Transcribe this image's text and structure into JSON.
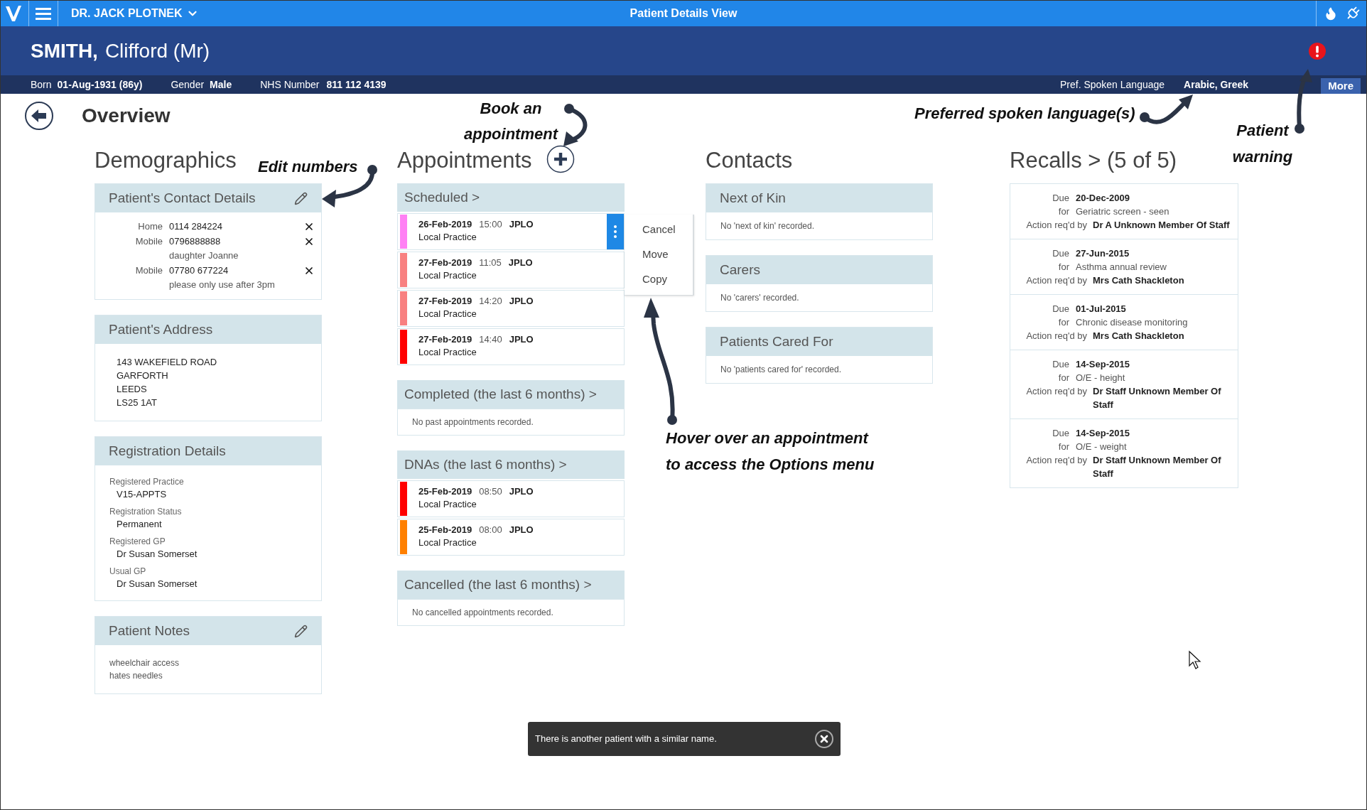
{
  "top_bar": {
    "user_name": "DR. JACK PLOTNEK",
    "title": "Patient Details View"
  },
  "patient": {
    "surname": "SMITH,",
    "given_name": "Clifford (Mr)",
    "born_label": "Born",
    "born": "01-Aug-1931 (86y)",
    "gender_label": "Gender",
    "gender": "Male",
    "nhs_label": "NHS Number",
    "nhs": "811 112 4139",
    "language_label": "Pref. Spoken Language",
    "language": "Arabic, Greek",
    "more_button": "More"
  },
  "page_title": "Overview",
  "demographics": {
    "heading": "Demographics",
    "contact_details": {
      "title": "Patient's Contact Details",
      "editable": true,
      "numbers": [
        {
          "type": "Home",
          "number": "0114 284224"
        },
        {
          "type": "Mobile",
          "number": "0796888888",
          "note": "daughter Joanne"
        },
        {
          "type": "Mobile",
          "number": "07780 677224",
          "note": "please only use after 3pm"
        }
      ]
    },
    "address": {
      "title": "Patient's Address",
      "editable": false,
      "lines": [
        "143 WAKEFIELD ROAD",
        "GARFORTH",
        "LEEDS",
        "LS25 1AT"
      ]
    },
    "registration": {
      "title": "Registration Details",
      "editable": false,
      "fields": [
        {
          "label": "Registered Practice",
          "value": "V15-APPTS"
        },
        {
          "label": "Registration Status",
          "value": "Permanent"
        },
        {
          "label": "Registered GP",
          "value": "Dr Susan Somerset"
        },
        {
          "label": "Usual GP",
          "value": "Dr Susan Somerset"
        }
      ]
    },
    "notes": {
      "title": "Patient Notes",
      "editable": true,
      "lines": [
        "wheelchair access",
        "hates needles"
      ]
    }
  },
  "appointments": {
    "heading": "Appointments",
    "options_menu": [
      "Cancel",
      "Move",
      "Copy"
    ],
    "sections": [
      {
        "title": "Scheduled >",
        "items": [
          {
            "date": "26-Feb-2019",
            "time": "15:00",
            "clinician": "JPLO",
            "location": "Local Practice",
            "color": "#ff80f4",
            "hovered": true
          },
          {
            "date": "27-Feb-2019",
            "time": "11:05",
            "clinician": "JPLO",
            "location": "Local Practice",
            "color": "#f88080",
            "hovered": false
          },
          {
            "date": "27-Feb-2019",
            "time": "14:20",
            "clinician": "JPLO",
            "location": "Local Practice",
            "color": "#f88080",
            "hovered": false
          },
          {
            "date": "27-Feb-2019",
            "time": "14:40",
            "clinician": "JPLO",
            "location": "Local Practice",
            "color": "#ff0000",
            "hovered": false
          }
        ]
      },
      {
        "title": "Completed (the last 6 months) >",
        "empty_text": "No past appointments recorded."
      },
      {
        "title": "DNAs (the last 6 months) >",
        "items": [
          {
            "date": "25-Feb-2019",
            "time": "08:50",
            "clinician": "JPLO",
            "location": "Local Practice",
            "color": "#ff0000",
            "hovered": false
          },
          {
            "date": "25-Feb-2019",
            "time": "08:00",
            "clinician": "JPLO",
            "location": "Local Practice",
            "color": "#ff8000",
            "hovered": false
          }
        ]
      },
      {
        "title": "Cancelled (the last 6 months) >",
        "empty_text": "No cancelled appointments recorded."
      }
    ]
  },
  "contacts": {
    "heading": "Contacts",
    "panels": [
      {
        "title": "Next of Kin",
        "empty_text": "No 'next of kin' recorded."
      },
      {
        "title": "Carers",
        "empty_text": "No 'carers' recorded."
      },
      {
        "title": "Patients Cared For",
        "empty_text": "No 'patients cared for' recorded."
      }
    ]
  },
  "recalls": {
    "heading": "Recalls > (5 of 5)",
    "items": [
      {
        "due_label": "Due",
        "due": "20-Dec-2009",
        "for_label": "for",
        "for": "Geriatric screen - seen",
        "action_label": "Action req'd by",
        "action_by": "Dr A Unknown Member Of Staff"
      },
      {
        "due_label": "Due",
        "due": "27-Jun-2015",
        "for_label": "for",
        "for": "Asthma annual review",
        "action_label": "Action req'd by",
        "action_by": "Mrs Cath Shackleton"
      },
      {
        "due_label": "Due",
        "due": "01-Jul-2015",
        "for_label": "for",
        "for": "Chronic disease monitoring",
        "action_label": "Action req'd by",
        "action_by": "Mrs Cath Shackleton"
      },
      {
        "due_label": "Due",
        "due": "14-Sep-2015",
        "for_label": "for",
        "for": "O/E - height",
        "action_label": "Action req'd by",
        "action_by": "Dr Staff Unknown Member Of Staff"
      },
      {
        "due_label": "Due",
        "due": "14-Sep-2015",
        "for_label": "for",
        "for": "O/E - weight",
        "action_label": "Action req'd by",
        "action_by": "Dr Staff Unknown Member Of Staff"
      }
    ]
  },
  "toast": {
    "message": "There is another patient with a similar name."
  },
  "annotations": [
    "Edit numbers",
    "Book an appointment",
    "Preferred spoken language(s)",
    "Patient warning",
    "Hover over an appointment to access the Options menu"
  ]
}
